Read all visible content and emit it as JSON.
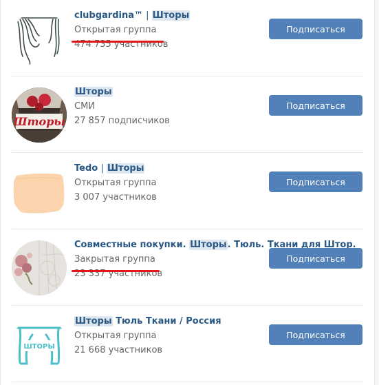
{
  "results": [
    {
      "title_parts": [
        "clubgardina™",
        " | ",
        "Шторы"
      ],
      "subtitle": "Открытая группа",
      "count": "474 735 участников",
      "button": "Подписаться",
      "avatar": "curtain-line-icon"
    },
    {
      "title_parts": [
        "",
        "",
        "Шторы"
      ],
      "subtitle": "СМИ",
      "count": "27 857 подписчиков",
      "button": "Подписаться",
      "avatar": "curtain-photo-logo",
      "avatar_text": "Шторы"
    },
    {
      "title_parts": [
        "Tedo",
        " | ",
        "Шторы"
      ],
      "subtitle": "Открытая группа",
      "count": "3 007 участников",
      "button": "Подписаться",
      "avatar": "peach-fabric-swatch"
    },
    {
      "title_parts": [
        "Совместные покупки. ",
        "",
        "Шторы",
        ". Тюль. Ткани для Штор."
      ],
      "subtitle": "Закрытая группа",
      "count": "23 337 участников",
      "button": "Подписаться",
      "avatar": "lace-flowers-photo"
    },
    {
      "title_parts": [
        "",
        "",
        "Шторы",
        " Тюль Ткани / Россия"
      ],
      "subtitle": "Открытая группа",
      "count": "21 668 участников",
      "button": "Подписаться",
      "avatar": "curtain-logo-icon",
      "avatar_text": "ШТОРЫ"
    }
  ],
  "colors": {
    "link": "#2a5885",
    "button": "#5181b8",
    "highlight": "#dee6ef",
    "annotation": "#e0161b"
  }
}
